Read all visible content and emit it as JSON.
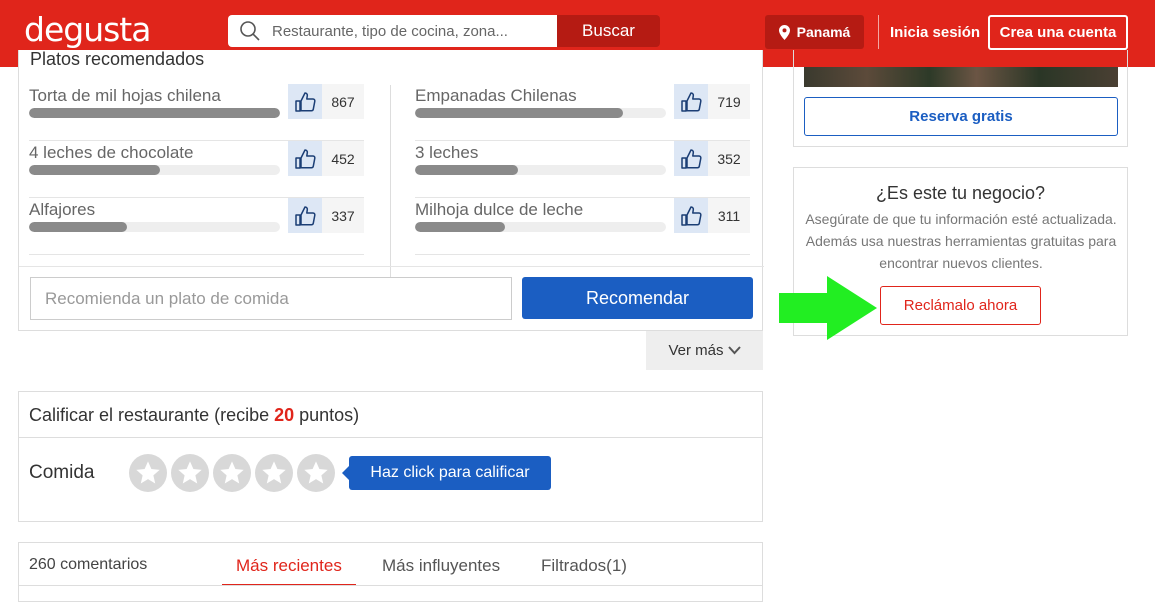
{
  "header": {
    "logo": "degusta",
    "search_placeholder": "Restaurante, tipo de cocina, zona...",
    "search_button": "Buscar",
    "location": "Panamá",
    "login": "Inicia sesión",
    "signup": "Crea una cuenta"
  },
  "dishes": {
    "title": "Platos recomendados",
    "left": [
      {
        "name": "Torta de mil hojas chilena",
        "count": "867",
        "fraction": 1.0
      },
      {
        "name": "4 leches de chocolate",
        "count": "452",
        "fraction": 0.52
      },
      {
        "name": "Alfajores",
        "count": "337",
        "fraction": 0.39
      }
    ],
    "right": [
      {
        "name": "Empanadas Chilenas",
        "count": "719",
        "fraction": 0.83
      },
      {
        "name": "3 leches",
        "count": "352",
        "fraction": 0.41
      },
      {
        "name": "Milhoja dulce de leche",
        "count": "311",
        "fraction": 0.36
      }
    ],
    "recommend_placeholder": "Recomienda un plato de comida",
    "recommend_button": "Recomendar",
    "more": "Ver más"
  },
  "rating": {
    "title_prefix": "Calificar el restaurante (recibe ",
    "points": "20",
    "title_suffix": " puntos)",
    "label": "Comida",
    "tooltip": "Haz click para calificar",
    "stars": 5
  },
  "comments": {
    "count": "260 comentarios",
    "tabs": [
      "Más recientes",
      "Más influyentes",
      "Filtrados(1)"
    ]
  },
  "sidebar": {
    "reserve_button": "Reserva gratis",
    "biz_title": "¿Es este tu negocio?",
    "biz_desc": "Asegúrate de que tu información esté actualizada. Además usa nuestras herramientas gratuitas para encontrar nuevos clientes.",
    "claim_button": "Reclámalo ahora"
  },
  "colors": {
    "brand_red": "#e0251b",
    "primary_blue": "#1b5ec2",
    "annotation_green": "#22ee22"
  }
}
